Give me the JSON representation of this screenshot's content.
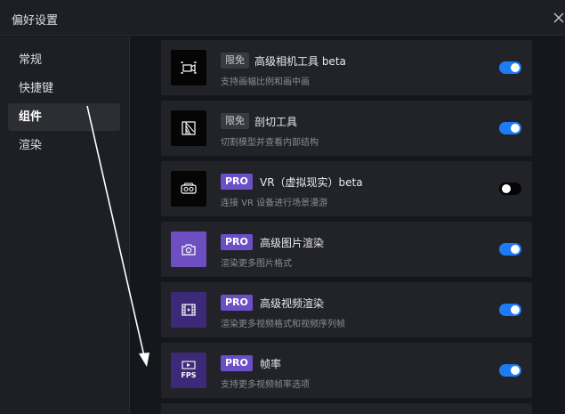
{
  "window": {
    "title": "偏好设置"
  },
  "sidebar": {
    "items": [
      {
        "label": "常规"
      },
      {
        "label": "快捷键"
      },
      {
        "label": "组件",
        "active": true
      },
      {
        "label": "渲染"
      }
    ]
  },
  "cards": [
    {
      "badge": "限免",
      "name": "高级相机工具 beta",
      "desc": "支持画幅比例和画中画",
      "icon": "camera-tool-icon",
      "enabled": true
    },
    {
      "badge": "限免",
      "name": "剖切工具",
      "desc": "切割模型并查看内部结构",
      "icon": "section-cut-icon",
      "enabled": true
    },
    {
      "badge": "PRO",
      "name": "VR（虚拟现实）beta",
      "desc": "连接 VR 设备进行场景漫游",
      "icon": "vr-headset-icon",
      "enabled": false
    },
    {
      "badge": "PRO",
      "name": "高级图片渲染",
      "desc": "渲染更多图片格式",
      "icon": "camera-icon",
      "enabled": true
    },
    {
      "badge": "PRO",
      "name": "高级视频渲染",
      "desc": "渲染更多视频格式和视频序列帧",
      "icon": "film-icon",
      "enabled": true
    },
    {
      "badge": "PRO",
      "name": "帧率",
      "desc": "支持更多视频帧率选项",
      "icon": "fps-icon",
      "icon_text": "FPS",
      "enabled": true
    }
  ],
  "colors": {
    "accent": "#1d7cf2",
    "pro_badge": "#6b4fc6",
    "annotation_arrow": "#ffffff"
  }
}
